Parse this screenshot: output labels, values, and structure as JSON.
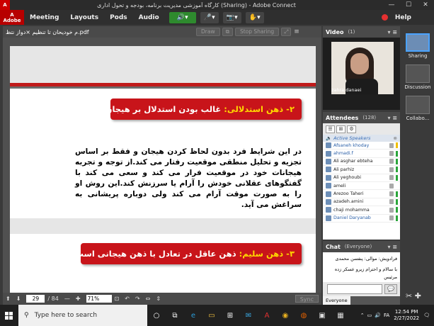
{
  "titlebar": {
    "title": "کارگاه آموزشی مدیریت برنامه، بودجه و تحول اداری (Sharing) - Adobe Connect",
    "min": "—",
    "max": "☐",
    "close": "✕"
  },
  "menu": {
    "items": [
      "Meeting",
      "Layouts",
      "Pods",
      "Audio"
    ],
    "help": "Help"
  },
  "share": {
    "filename": "م خودیحان تا تنظیم ×دواز نتظ.pdf",
    "buttons": [
      "Draw",
      "Stop Sharing"
    ]
  },
  "slide": {
    "heading1_prefix": "۲- ذهن استدلالی:",
    "heading1_rest": " غالب بودن استدلال بر هیجان",
    "paragraph": "در این شرایط فرد بدون لحاظ کردن هیجان و فقط بر اساس تجزیه و تحلیل منطقی موقعیت رفتار می کند.از توجه و تجربه هیجانات خود در موقعیت فرار می کند و سعی می کند با گفتگوهای عقلانی خودش را آرام یا سرزنش کند.این روش او را به صورت موقت آرام می کند ولی دوباره پریشانی به سراغش می آید.",
    "heading2_prefix": "۳- ذهن سلیم:",
    "heading2_rest": " ذهن عاقل در تعادل با ذهن هیجانی است"
  },
  "nav": {
    "page": "29",
    "total": "/ 84",
    "zoom": "71%",
    "sync": "Sync"
  },
  "video": {
    "title": "Video",
    "count": "(1)",
    "participant": "zahra danaei"
  },
  "attendees": {
    "title": "Attendees",
    "count": "(128)",
    "active_speakers": "Active Speakers",
    "list": [
      {
        "name": "Afsaneh khoday",
        "status": "#f0c000",
        "active": true
      },
      {
        "name": "ahmadi.f",
        "status": "#2aa63a",
        "active": true
      },
      {
        "name": "Ali asghar ebteha",
        "status": "#2aa63a",
        "active": false
      },
      {
        "name": "Ali parhiz",
        "status": "#2aa63a",
        "active": false
      },
      {
        "name": "Ali yeghoubi",
        "status": "#2aa63a",
        "active": false
      },
      {
        "name": "ameli",
        "status": "#ffffff",
        "active": false
      },
      {
        "name": "Arezoo Taheri",
        "status": "#2aa63a",
        "active": false
      },
      {
        "name": "azadeh.amini",
        "status": "#2aa63a",
        "active": false
      },
      {
        "name": "chaji mohamma",
        "status": "#2aa63a",
        "active": false
      },
      {
        "name": "Daniel Daryanab",
        "status": "#2aa63a",
        "active": true
      }
    ]
  },
  "chat": {
    "title": "Chat",
    "audience": "(Everyone)",
    "messages": [
      "فرادویش: موالی: پنفسن محمدی",
      "با سالام و احترام زیرو عسکر زده مرئیس"
    ],
    "tab": "Everyone"
  },
  "layouts": [
    "Sharing",
    "Discussion",
    "Collabo..."
  ],
  "taskbar": {
    "search_placeholder": "Type here to search",
    "time": "12:54 PM",
    "date": "2/27/2022",
    "lang": "FA"
  }
}
